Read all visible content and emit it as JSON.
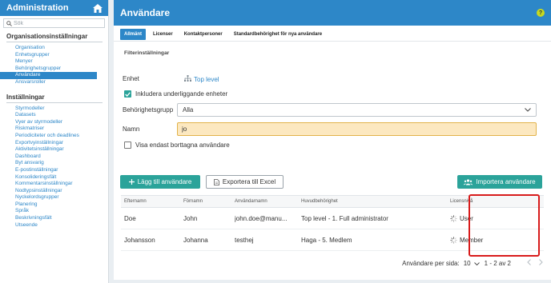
{
  "sidebar": {
    "title": "Administration",
    "search_placeholder": "Sök",
    "sections": [
      {
        "title": "Organisationsinställningar",
        "items": [
          "Organisation",
          "Enhetsgrupper",
          "Menyer",
          "Behörighetsgrupper",
          "Användare",
          "Ansvarsroller"
        ]
      },
      {
        "title": "Inställningar",
        "items": [
          "Styrmodeller",
          "Datasets",
          "Vyer av styrmodeller",
          "Riskmatriser",
          "Periodiciteter och deadlines",
          "Exportvyinställningar",
          "Aktivitetsinställningar",
          "Dashboard",
          "Byt ansvarig",
          "E-postinställningar",
          "Konsolideringsfält",
          "Kommentarsinställningar",
          "Nodtypsinställningar",
          "Nyckelordsgrupper",
          "Planering",
          "Språk",
          "Beskrivningsfält",
          "Utseende"
        ]
      }
    ],
    "active_item": "Användare"
  },
  "header": {
    "title": "Användare",
    "help": "?"
  },
  "tabs": [
    "Allmänt",
    "Licenser",
    "Kontaktpersoner",
    "Standardbehörighet för nya användare"
  ],
  "filter": {
    "title": "Filterinställningar",
    "unit_label": "Enhet",
    "unit_value": "Top level",
    "include_sub_label": "Inkludera underliggande enheter",
    "group_label": "Behörighetsgrupp",
    "group_value": "Alla",
    "name_label": "Namn",
    "name_value": "jo",
    "deleted_label": "Visa endast borttagna användare"
  },
  "buttons": {
    "add_user": "Lägg till användare",
    "export": "Exportera till Excel",
    "import": "Importera användare"
  },
  "table": {
    "headers": [
      "Efternamn",
      "Förnamn",
      "Användarnamn",
      "Huvudbehörighet",
      "Licensnivå"
    ],
    "rows": [
      [
        "Doe",
        "John",
        "john.doe@manu...",
        "Top level - 1. Full administrator",
        "User"
      ],
      [
        "Johansson",
        "Johanna",
        "testhej",
        "Haga - 5. Medlem",
        "Member"
      ]
    ]
  },
  "pagination": {
    "per_page_label": "Användare per sida:",
    "per_page_value": "10",
    "range": "1 - 2 av 2"
  },
  "colors": {
    "brand": "#2d87c8",
    "teal": "#2ba39a",
    "highlight": "#d81b1b",
    "input_focus_bg": "#fce8c0"
  }
}
